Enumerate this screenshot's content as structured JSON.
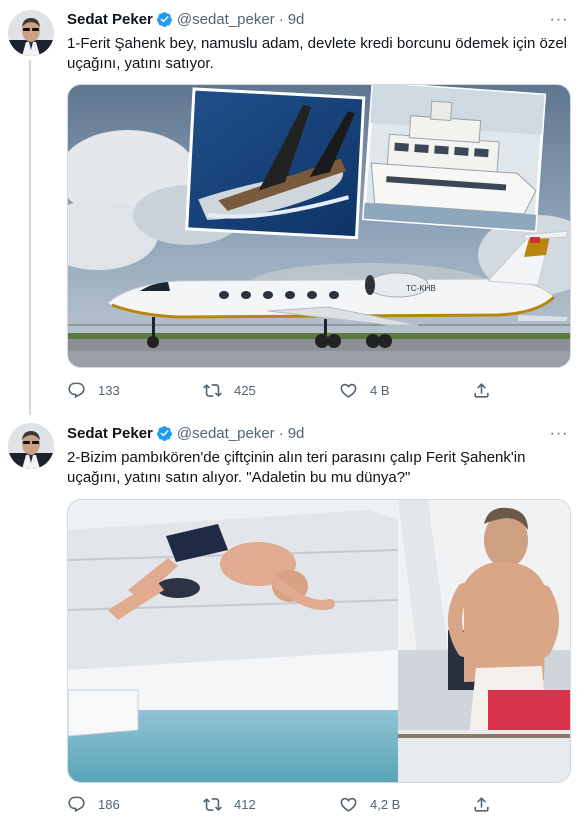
{
  "colors": {
    "accent": "#1d9bf0",
    "secondary_text": "#536471",
    "primary_text": "#0f1419",
    "thread_line": "#cfd9de"
  },
  "tweets": [
    {
      "author_name": "Sedat Peker",
      "author_handle": "@sedat_peker",
      "separator": "·",
      "time": "9d",
      "more_label": "···",
      "text": "1-Ferit Şahenk bey, namuslu adam, devlete kredi borcunu ödemek için özel uçağını, yatını satıyor.",
      "image_alt": "Private jet with inset photos of a sailing yacht and a motor yacht",
      "jet_registration": "TC-KHB",
      "reply_count": "133",
      "retweet_count": "425",
      "like_count": "4 B",
      "icons": [
        "reply-icon",
        "retweet-icon",
        "like-icon",
        "share-icon"
      ]
    },
    {
      "author_name": "Sedat Peker",
      "author_handle": "@sedat_peker",
      "separator": "·",
      "time": "9d",
      "more_label": "···",
      "text": "2-Bizim pambıkören'de çiftçinin alın teri parasını çalıp Ferit Şahenk'in uçağını, yatını satın alıyor.   \"Adaletin bu mu dünya?\"",
      "image_alt": "Man diving from a yacht and shirtless man standing on deck",
      "reply_count": "186",
      "retweet_count": "412",
      "like_count": "4,2 B",
      "icons": [
        "reply-icon",
        "retweet-icon",
        "like-icon",
        "share-icon"
      ]
    }
  ]
}
